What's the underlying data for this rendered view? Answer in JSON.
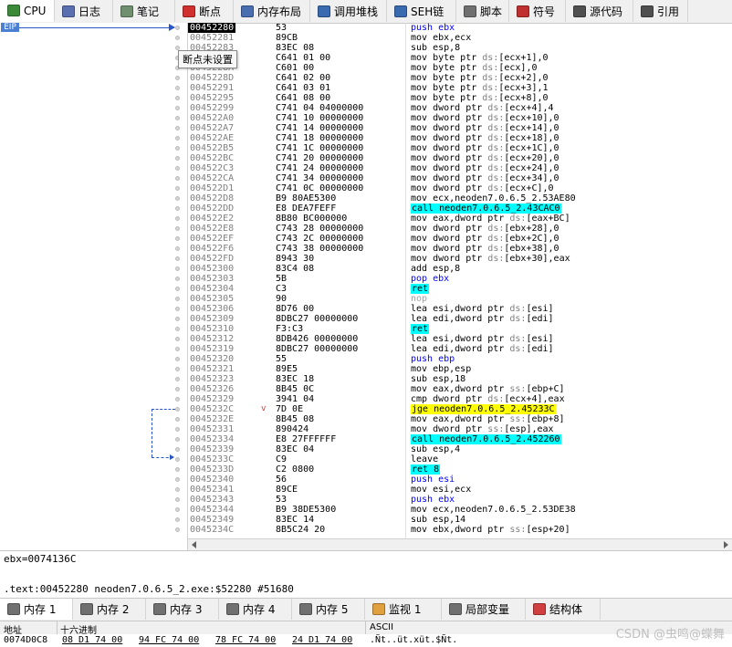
{
  "tabs": [
    {
      "label": "CPU",
      "icon": "cpu-icon",
      "color": "#3a8a3a"
    },
    {
      "label": "日志",
      "icon": "log-icon",
      "color": "#5a6fb0"
    },
    {
      "label": "笔记",
      "icon": "notes-icon",
      "color": "#6f8f6f"
    },
    {
      "label": "断点",
      "icon": "breakpoint-icon",
      "color": "#d03030"
    },
    {
      "label": "内存布局",
      "icon": "memory-map-icon",
      "color": "#4a6fb0"
    },
    {
      "label": "调用堆栈",
      "icon": "call-stack-icon",
      "color": "#3a6ab0"
    },
    {
      "label": "SEH链",
      "icon": "seh-icon",
      "color": "#3a6ab0"
    },
    {
      "label": "脚本",
      "icon": "script-icon",
      "color": "#707070"
    },
    {
      "label": "符号",
      "icon": "symbols-icon",
      "color": "#c03030"
    },
    {
      "label": "源代码",
      "icon": "source-icon",
      "color": "#505050"
    },
    {
      "label": "引用",
      "icon": "references-icon",
      "color": "#505050"
    }
  ],
  "eip_label": "EIP",
  "tooltip": "断点未设置",
  "disasm": [
    {
      "addr": "00452280",
      "bytes": "53",
      "ins": "push ebx",
      "cls": "push",
      "cur": true
    },
    {
      "addr": "00452281",
      "bytes": "89CB",
      "ins": "mov ebx,ecx"
    },
    {
      "addr": "00452283",
      "bytes": "83EC 08",
      "ins": "sub esp,8"
    },
    {
      "addr": "00452286",
      "bytes": "C641 01 00",
      "ins": "mov byte ptr ds:[ecx+1],0"
    },
    {
      "addr": "0045228A",
      "bytes": "C601 00",
      "ins": "mov byte ptr ds:[ecx],0"
    },
    {
      "addr": "0045228D",
      "bytes": "C641 02 00",
      "ins": "mov byte ptr ds:[ecx+2],0"
    },
    {
      "addr": "00452291",
      "bytes": "C641 03 01",
      "ins": "mov byte ptr ds:[ecx+3],1"
    },
    {
      "addr": "00452295",
      "bytes": "C641 08 00",
      "ins": "mov byte ptr ds:[ecx+8],0"
    },
    {
      "addr": "00452299",
      "bytes": "C741 04 04000000",
      "ins": "mov dword ptr ds:[ecx+4],4"
    },
    {
      "addr": "004522A0",
      "bytes": "C741 10 00000000",
      "ins": "mov dword ptr ds:[ecx+10],0"
    },
    {
      "addr": "004522A7",
      "bytes": "C741 14 00000000",
      "ins": "mov dword ptr ds:[ecx+14],0"
    },
    {
      "addr": "004522AE",
      "bytes": "C741 18 00000000",
      "ins": "mov dword ptr ds:[ecx+18],0"
    },
    {
      "addr": "004522B5",
      "bytes": "C741 1C 00000000",
      "ins": "mov dword ptr ds:[ecx+1C],0"
    },
    {
      "addr": "004522BC",
      "bytes": "C741 20 00000000",
      "ins": "mov dword ptr ds:[ecx+20],0"
    },
    {
      "addr": "004522C3",
      "bytes": "C741 24 00000000",
      "ins": "mov dword ptr ds:[ecx+24],0"
    },
    {
      "addr": "004522CA",
      "bytes": "C741 34 00000000",
      "ins": "mov dword ptr ds:[ecx+34],0"
    },
    {
      "addr": "004522D1",
      "bytes": "C741 0C 00000000",
      "ins": "mov dword ptr ds:[ecx+C],0"
    },
    {
      "addr": "004522D8",
      "bytes": "B9 80AE5300",
      "ins": "mov ecx,neoden7.0.6.5_2.53AE80"
    },
    {
      "addr": "004522DD",
      "bytes": "E8 DEA7FEFF",
      "ins": "call neoden7.0.6.5_2.43CAC0",
      "cls": "call"
    },
    {
      "addr": "004522E2",
      "bytes": "8B80 BC000000",
      "ins": "mov eax,dword ptr ds:[eax+BC]"
    },
    {
      "addr": "004522E8",
      "bytes": "C743 28 00000000",
      "ins": "mov dword ptr ds:[ebx+28],0"
    },
    {
      "addr": "004522EF",
      "bytes": "C743 2C 00000000",
      "ins": "mov dword ptr ds:[ebx+2C],0"
    },
    {
      "addr": "004522F6",
      "bytes": "C743 38 00000000",
      "ins": "mov dword ptr ds:[ebx+38],0"
    },
    {
      "addr": "004522FD",
      "bytes": "8943 30",
      "ins": "mov dword ptr ds:[ebx+30],eax"
    },
    {
      "addr": "00452300",
      "bytes": "83C4 08",
      "ins": "add esp,8"
    },
    {
      "addr": "00452303",
      "bytes": "5B",
      "ins": "pop ebx",
      "cls": "push"
    },
    {
      "addr": "00452304",
      "bytes": "C3",
      "ins": "ret",
      "cls": "ret"
    },
    {
      "addr": "00452305",
      "bytes": "90",
      "ins": "nop",
      "cls": "nop"
    },
    {
      "addr": "00452306",
      "bytes": "8D76 00",
      "ins": "lea esi,dword ptr ds:[esi]"
    },
    {
      "addr": "00452309",
      "bytes": "8DBC27 00000000",
      "ins": "lea edi,dword ptr ds:[edi]"
    },
    {
      "addr": "00452310",
      "bytes": "F3:C3",
      "ins": "ret",
      "cls": "ret"
    },
    {
      "addr": "00452312",
      "bytes": "8DB426 00000000",
      "ins": "lea esi,dword ptr ds:[esi]"
    },
    {
      "addr": "00452319",
      "bytes": "8DBC27 00000000",
      "ins": "lea edi,dword ptr ds:[edi]"
    },
    {
      "addr": "00452320",
      "bytes": "55",
      "ins": "push ebp",
      "cls": "push"
    },
    {
      "addr": "00452321",
      "bytes": "89E5",
      "ins": "mov ebp,esp"
    },
    {
      "addr": "00452323",
      "bytes": "83EC 18",
      "ins": "sub esp,18"
    },
    {
      "addr": "00452326",
      "bytes": "8B45 0C",
      "ins": "mov eax,dword ptr ss:[ebp+C]"
    },
    {
      "addr": "00452329",
      "bytes": "3941 04",
      "ins": "cmp dword ptr ds:[ecx+4],eax"
    },
    {
      "addr": "0045232C",
      "bytes": "7D 0E",
      "ins": "jge neoden7.0.6.5_2.45233C",
      "cls": "jmp",
      "mark": "v"
    },
    {
      "addr": "0045232E",
      "bytes": "8B45 08",
      "ins": "mov eax,dword ptr ss:[ebp+8]"
    },
    {
      "addr": "00452331",
      "bytes": "890424",
      "ins": "mov dword ptr ss:[esp],eax"
    },
    {
      "addr": "00452334",
      "bytes": "E8 27FFFFFF",
      "ins": "call neoden7.0.6.5_2.452260",
      "cls": "call"
    },
    {
      "addr": "00452339",
      "bytes": "83EC 04",
      "ins": "sub esp,4"
    },
    {
      "addr": "0045233C",
      "bytes": "C9",
      "ins": "leave"
    },
    {
      "addr": "0045233D",
      "bytes": "C2 0800",
      "ins": "ret 8",
      "cls": "ret"
    },
    {
      "addr": "00452340",
      "bytes": "56",
      "ins": "push esi",
      "cls": "push"
    },
    {
      "addr": "00452341",
      "bytes": "89CE",
      "ins": "mov esi,ecx"
    },
    {
      "addr": "00452343",
      "bytes": "53",
      "ins": "push ebx",
      "cls": "push"
    },
    {
      "addr": "00452344",
      "bytes": "B9 38DE5300",
      "ins": "mov ecx,neoden7.0.6.5_2.53DE38"
    },
    {
      "addr": "00452349",
      "bytes": "83EC 14",
      "ins": "sub esp,14"
    },
    {
      "addr": "0045234C",
      "bytes": "8B5C24 20",
      "ins": "mov ebx,dword ptr ss:[esp+20]"
    }
  ],
  "info_line1": "ebx=0074136C",
  "info_line2": ".text:00452280 neoden7.0.6.5_2.exe:$52280 #51680",
  "bottom_tabs": [
    {
      "label": "内存 1",
      "icon": "memory-icon"
    },
    {
      "label": "内存 2",
      "icon": "memory-icon"
    },
    {
      "label": "内存 3",
      "icon": "memory-icon"
    },
    {
      "label": "内存 4",
      "icon": "memory-icon"
    },
    {
      "label": "内存 5",
      "icon": "memory-icon"
    },
    {
      "label": "监视 1",
      "icon": "watch-icon"
    },
    {
      "label": "局部变量",
      "icon": "locals-icon"
    },
    {
      "label": "结构体",
      "icon": "struct-icon"
    }
  ],
  "dump": {
    "col_addr": "地址",
    "col_hex": "十六进制",
    "col_ascii": "ASCII",
    "row_addr": "0074D0C8",
    "hex_groups": [
      "08 D1 74 00",
      "94 FC 74 00",
      "78 FC 74 00",
      "24 D1 74 00"
    ],
    "ascii": ".Ñt..üt.xüt.$Ñt."
  },
  "watermark": "CSDN @虫鸣@蝶舞"
}
